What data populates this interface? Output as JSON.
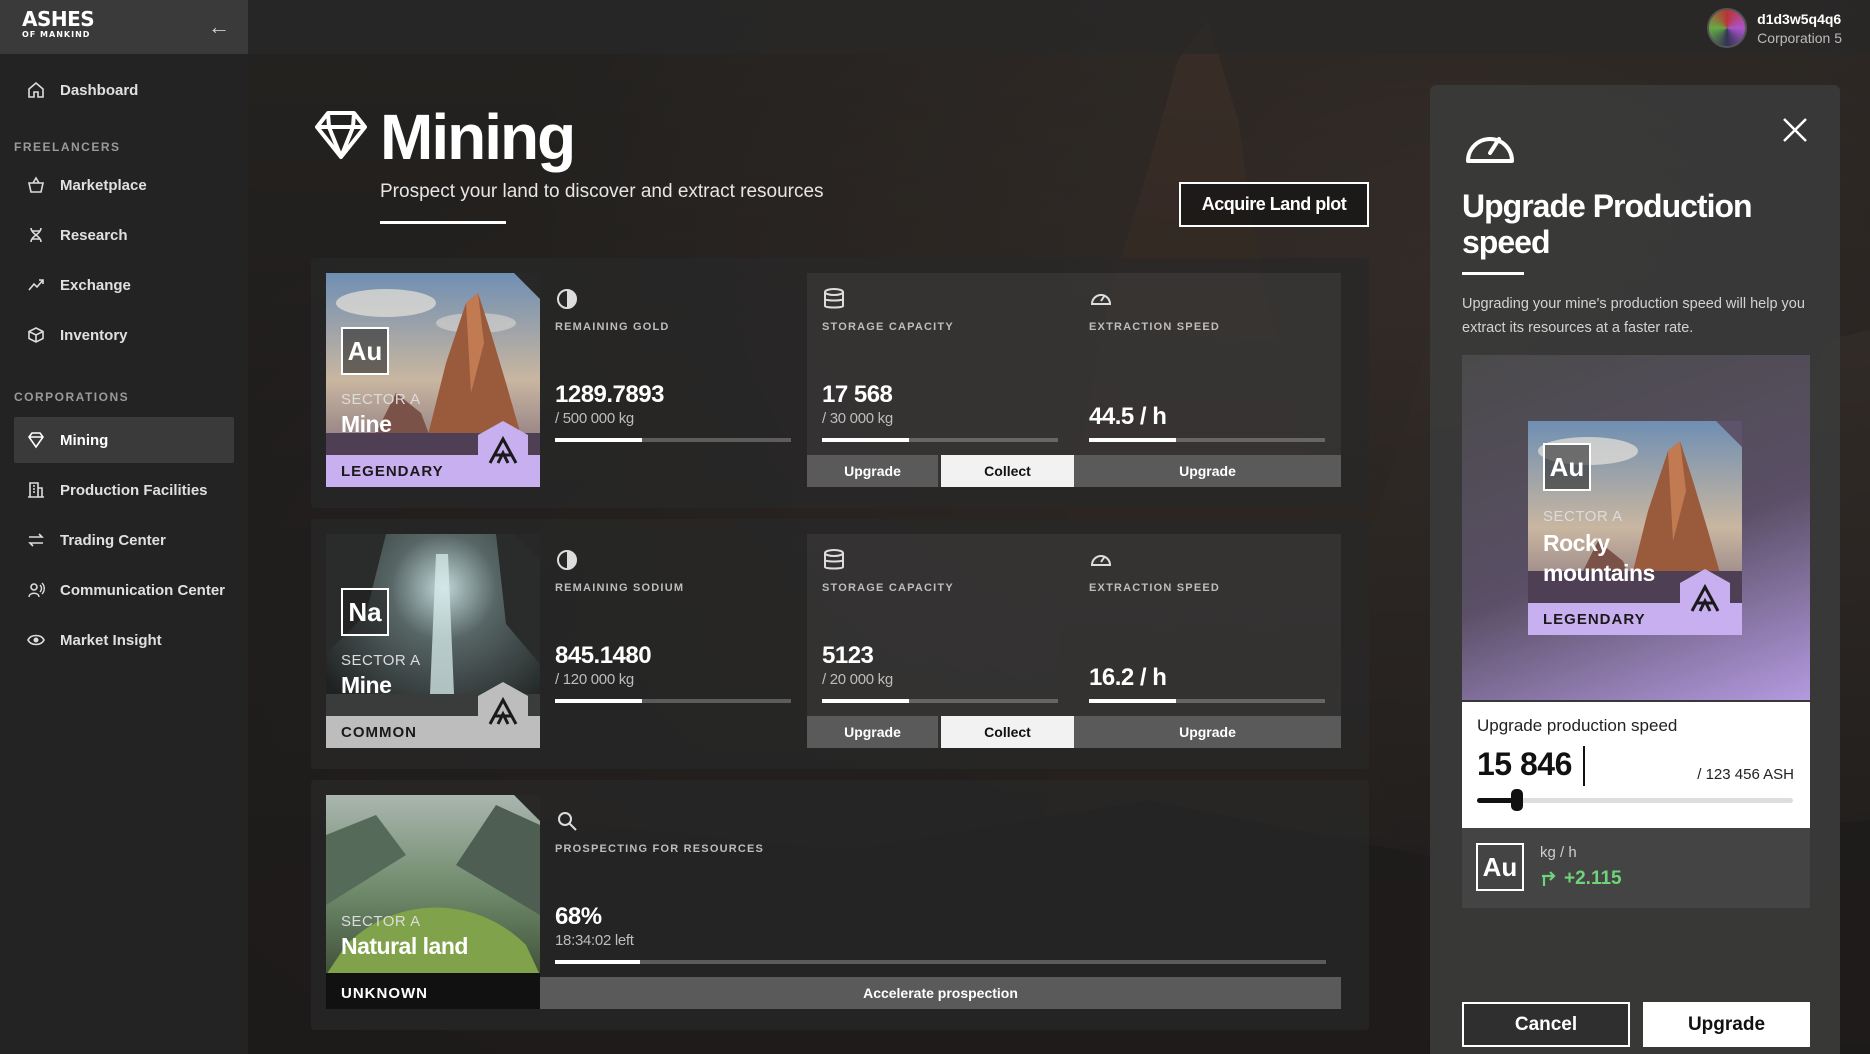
{
  "app": {
    "logo_main": "ASHES",
    "logo_sub": "OF MANKIND",
    "back_icon": "arrow-left-icon"
  },
  "user": {
    "name": "d1d3w5q4q6",
    "corporation": "Corporation 5"
  },
  "sidebar": {
    "dashboard": "Dashboard",
    "freelancers_heading": "FREELANCERS",
    "freelancers": [
      {
        "label": "Marketplace",
        "icon": "basket-icon"
      },
      {
        "label": "Research",
        "icon": "dna-icon"
      },
      {
        "label": "Exchange",
        "icon": "trend-icon"
      },
      {
        "label": "Inventory",
        "icon": "box-icon"
      }
    ],
    "corporations_heading": "CORPORATIONS",
    "corporations": [
      {
        "label": "Mining",
        "icon": "diamond-icon",
        "active": true
      },
      {
        "label": "Production Facilities",
        "icon": "building-icon"
      },
      {
        "label": "Trading Center",
        "icon": "swap-icon"
      },
      {
        "label": "Communication Center",
        "icon": "broadcast-icon"
      },
      {
        "label": "Market Insight",
        "icon": "eye-icon"
      }
    ]
  },
  "header": {
    "title": "Mining",
    "subtitle": "Prospect your land to discover and extract resources",
    "acquire_button": "Acquire Land plot"
  },
  "mines": [
    {
      "element": "Au",
      "sector": "SECTOR A",
      "name": "Mine",
      "rarity": "LEGENDARY",
      "rarity_color": "#c8b0f0",
      "remaining_label": "REMAINING GOLD",
      "remaining_value": "1289.7893",
      "remaining_total": "/ 500 000 kg",
      "remaining_fraction": 0.37,
      "storage_label": "STORAGE CAPACITY",
      "storage_value": "17 568",
      "storage_total": "/ 30 000 kg",
      "storage_fraction": 0.37,
      "speed_label": "EXTRACTION SPEED",
      "speed_value": "44.5 / h",
      "speed_fraction": 0.37,
      "upgrade": "Upgrade",
      "collect": "Collect",
      "speed_upgrade": "Upgrade"
    },
    {
      "element": "Na",
      "sector": "SECTOR A",
      "name": "Mine",
      "rarity": "COMMON",
      "rarity_color": "#bdbdbd",
      "remaining_label": "REMAINING SODIUM",
      "remaining_value": "845.1480",
      "remaining_total": "/ 120 000 kg",
      "remaining_fraction": 0.37,
      "storage_label": "STORAGE CAPACITY",
      "storage_value": "5123",
      "storage_total": "/ 20 000 kg",
      "storage_fraction": 0.37,
      "speed_label": "EXTRACTION SPEED",
      "speed_value": "16.2 / h",
      "speed_fraction": 0.37,
      "upgrade": "Upgrade",
      "collect": "Collect",
      "speed_upgrade": "Upgrade"
    }
  ],
  "prospect": {
    "sector": "SECTOR A",
    "name": "Natural land",
    "rarity": "UNKNOWN",
    "label": "PROSPECTING FOR RESOURCES",
    "percent": "68%",
    "time_left": "18:34:02 left",
    "fraction": 0.11,
    "button": "Accelerate prospection"
  },
  "panel": {
    "title": "Upgrade Production speed",
    "description": "Upgrading your mine's production speed will help you extract its resources at a faster rate.",
    "preview": {
      "element": "Au",
      "sector": "SECTOR A",
      "name": "Rocky mountains",
      "rarity": "LEGENDARY"
    },
    "slider_label": "Upgrade production speed",
    "slider_value": "15 846",
    "slider_max": "/ 123 456 ASH",
    "slider_fraction": 0.128,
    "result_element": "Au",
    "result_unit": "kg / h",
    "result_delta": "+2.115",
    "cancel": "Cancel",
    "upgrade": "Upgrade"
  }
}
